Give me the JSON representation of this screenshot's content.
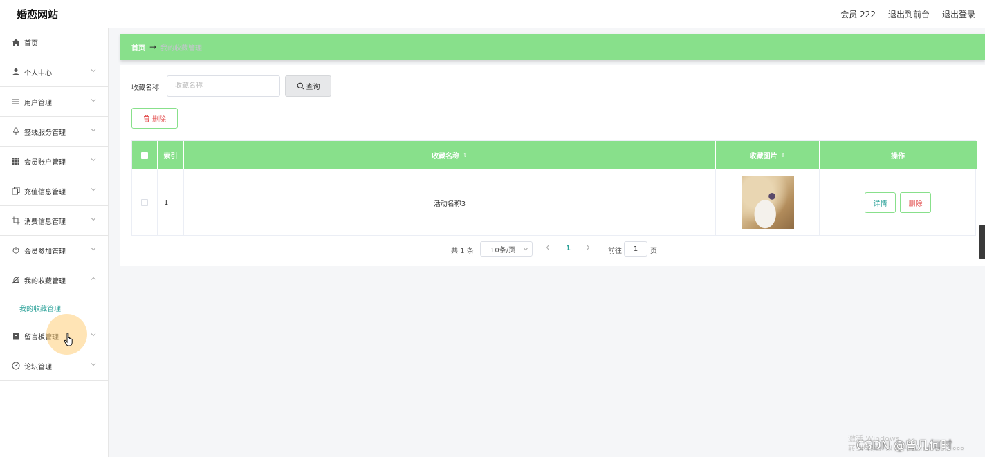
{
  "app": {
    "title": "婚恋网站"
  },
  "header": {
    "member_label": "会员 222",
    "goto_front": "退出到前台",
    "logout": "退出登录"
  },
  "sidebar": {
    "items": [
      {
        "label": "首页",
        "icon": "home-icon"
      },
      {
        "label": "个人中心",
        "icon": "user-icon"
      },
      {
        "label": "用户管理",
        "icon": "list-icon"
      },
      {
        "label": "签线服务管理",
        "icon": "microphone-icon"
      },
      {
        "label": "会员账户管理",
        "icon": "grid-icon"
      },
      {
        "label": "充值信息管理",
        "icon": "copy-icon"
      },
      {
        "label": "消费信息管理",
        "icon": "crop-icon"
      },
      {
        "label": "会员参加管理",
        "icon": "power-icon"
      },
      {
        "label": "我的收藏管理",
        "icon": "bell-off-icon"
      },
      {
        "label": "留言板管理",
        "icon": "clipboard-icon"
      },
      {
        "label": "论坛管理",
        "icon": "gauge-icon"
      }
    ],
    "active_submenu": "我的收藏管理"
  },
  "breadcrumb": {
    "home": "首页",
    "separator": "→",
    "current": "我的收藏管理"
  },
  "search": {
    "label": "收藏名称",
    "placeholder": "收藏名称",
    "value": "",
    "button": "查询"
  },
  "actions": {
    "delete": "删除"
  },
  "table": {
    "columns": [
      "索引",
      "收藏名称",
      "收藏图片",
      "操作"
    ],
    "rows": [
      {
        "index": "1",
        "name": "活动名称3",
        "image": "wedding-photo",
        "detail": "详情",
        "delete": "删除"
      }
    ]
  },
  "pagination": {
    "total": "共 1 条",
    "page_size": "10条/页",
    "current_page": "1",
    "goto_label": "前往",
    "goto_value": "1",
    "page_suffix": "页"
  },
  "overlay": {
    "watermark_line1": "激活 Windows",
    "watermark_line2": "转到\"设置\"以激活 Windows。",
    "csdn": "CSDN @曾几何时…"
  },
  "colors": {
    "accent_green": "#88e08b",
    "teal_text": "#2aa198",
    "danger": "#e45757"
  }
}
